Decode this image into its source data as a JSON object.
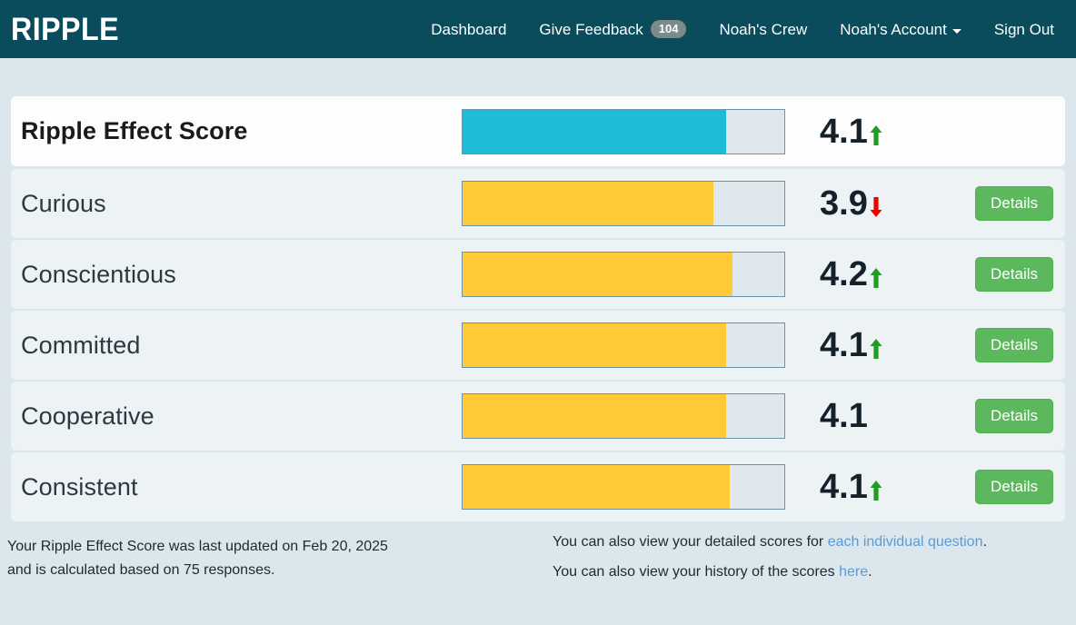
{
  "navbar": {
    "brand": "RIPPLE",
    "items": [
      {
        "label": "Dashboard",
        "badge": null,
        "caret": false
      },
      {
        "label": "Give Feedback",
        "badge": "104",
        "caret": false
      },
      {
        "label": "Noah's Crew",
        "badge": null,
        "caret": false
      },
      {
        "label": "Noah's Account",
        "badge": null,
        "caret": true
      },
      {
        "label": "Sign Out",
        "badge": null,
        "caret": false
      }
    ],
    "background_color": "#0a4c5c"
  },
  "scores": {
    "details_label": "Details",
    "rows": [
      {
        "label": "Ripple Effect Score",
        "value": "4.1",
        "trend": "up",
        "fill_percent": 82,
        "bar_color": "#1fbcd8",
        "primary": true,
        "has_details": false
      },
      {
        "label": "Curious",
        "value": "3.9",
        "trend": "down",
        "fill_percent": 78,
        "bar_color": "#ffc938",
        "primary": false,
        "has_details": true
      },
      {
        "label": "Conscientious",
        "value": "4.2",
        "trend": "up",
        "fill_percent": 84,
        "bar_color": "#ffc938",
        "primary": false,
        "has_details": true
      },
      {
        "label": "Committed",
        "value": "4.1",
        "trend": "up",
        "fill_percent": 82,
        "bar_color": "#ffc938",
        "primary": false,
        "has_details": true
      },
      {
        "label": "Cooperative",
        "value": "4.1",
        "trend": "none",
        "fill_percent": 82,
        "bar_color": "#ffc938",
        "primary": false,
        "has_details": true
      },
      {
        "label": "Consistent",
        "value": "4.1",
        "trend": "up",
        "fill_percent": 83,
        "bar_color": "#ffc938",
        "primary": false,
        "has_details": true
      }
    ],
    "trend_up_color": "#1f9d22",
    "trend_down_color": "#ee0000"
  },
  "footer": {
    "left_line1": "Your Ripple Effect Score was last updated on Feb 20, 2025",
    "left_line2": "and is calculated based on 75 responses.",
    "right_line1_prefix": "You can also view your detailed scores for ",
    "right_line1_link": "each individual question",
    "right_line1_suffix": ".",
    "right_line2_prefix": "You can also view your history of the scores ",
    "right_line2_link": "here",
    "right_line2_suffix": ".",
    "link_color": "#5b9bd5"
  }
}
